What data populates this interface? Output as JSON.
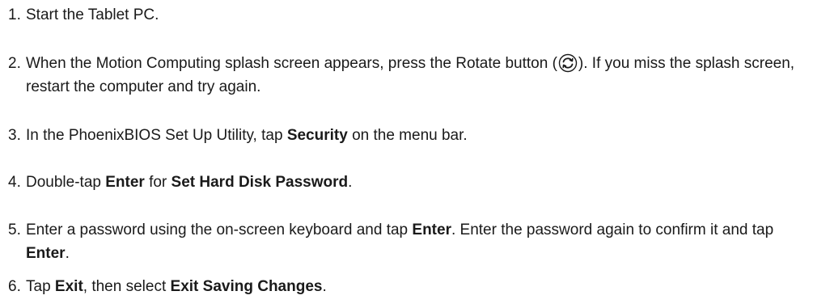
{
  "steps": [
    {
      "number": "1.",
      "text": "Start the Tablet PC."
    },
    {
      "number": "2.",
      "text_a": "When the Motion Computing splash screen appears, press the Rotate button (",
      "icon": "rotate-button-icon",
      "text_b": "). If you miss the splash screen, restart the computer and try again."
    },
    {
      "number": "3.",
      "text_a": "In the PhoenixBIOS Set Up Utility, tap ",
      "bold_a": "Security",
      "text_b": " on the menu bar."
    },
    {
      "number": "4.",
      "text_a": "Double-tap ",
      "bold_a": "Enter",
      "text_b": " for ",
      "bold_b": "Set Hard Disk Password",
      "text_c": "."
    },
    {
      "number": "5.",
      "text_a": "Enter a password using the on-screen keyboard and tap ",
      "bold_a": "Enter",
      "text_b": ". Enter the password again to confirm it and tap ",
      "bold_b": "Enter",
      "text_c": "."
    },
    {
      "number": "6.",
      "text_a": "Tap ",
      "bold_a": "Exit",
      "text_b": ", then select ",
      "bold_b": "Exit Saving Changes",
      "text_c": "."
    }
  ]
}
